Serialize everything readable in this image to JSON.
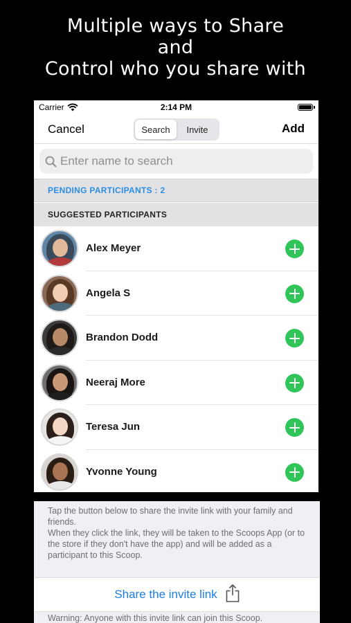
{
  "headline": [
    "Multiple ways to Share",
    "and",
    "Control who you share with"
  ],
  "status_bar": {
    "carrier": "Carrier",
    "time": "2:14 PM"
  },
  "nav": {
    "cancel": "Cancel",
    "add": "Add",
    "tabs": [
      "Search",
      "Invite"
    ],
    "active_tab": "Search"
  },
  "search": {
    "placeholder": "Enter name to search"
  },
  "sections": {
    "pending": "PENDING PARTICIPANTS : 2",
    "suggested": "SUGGESTED PARTICIPANTS"
  },
  "participants": [
    {
      "name": "Alex Meyer"
    },
    {
      "name": "Angela S"
    },
    {
      "name": "Brandon Dodd"
    },
    {
      "name": "Neeraj More"
    },
    {
      "name": "Teresa Jun"
    },
    {
      "name": "Yvonne Young"
    }
  ],
  "invite_panel": {
    "info_line1": "Tap the button below to share the invite link with your family and friends.",
    "info_line2": "When they click the link, they will be taken to the Scoops App (or to the store if they don't have the app) and will be added as a participant to this Scoop.",
    "share_label": "Share the invite link",
    "warning": "Warning: Anyone with this invite link can join this Scoop."
  },
  "colors": {
    "accent_blue": "#1a7fe0",
    "add_green": "#2fc559",
    "section_bg": "#e2e2e4"
  },
  "icons": {
    "search": "magnifier-icon",
    "add": "plus-circle-icon",
    "share": "share-icon",
    "wifi": "wifi-icon",
    "battery": "battery-icon"
  }
}
